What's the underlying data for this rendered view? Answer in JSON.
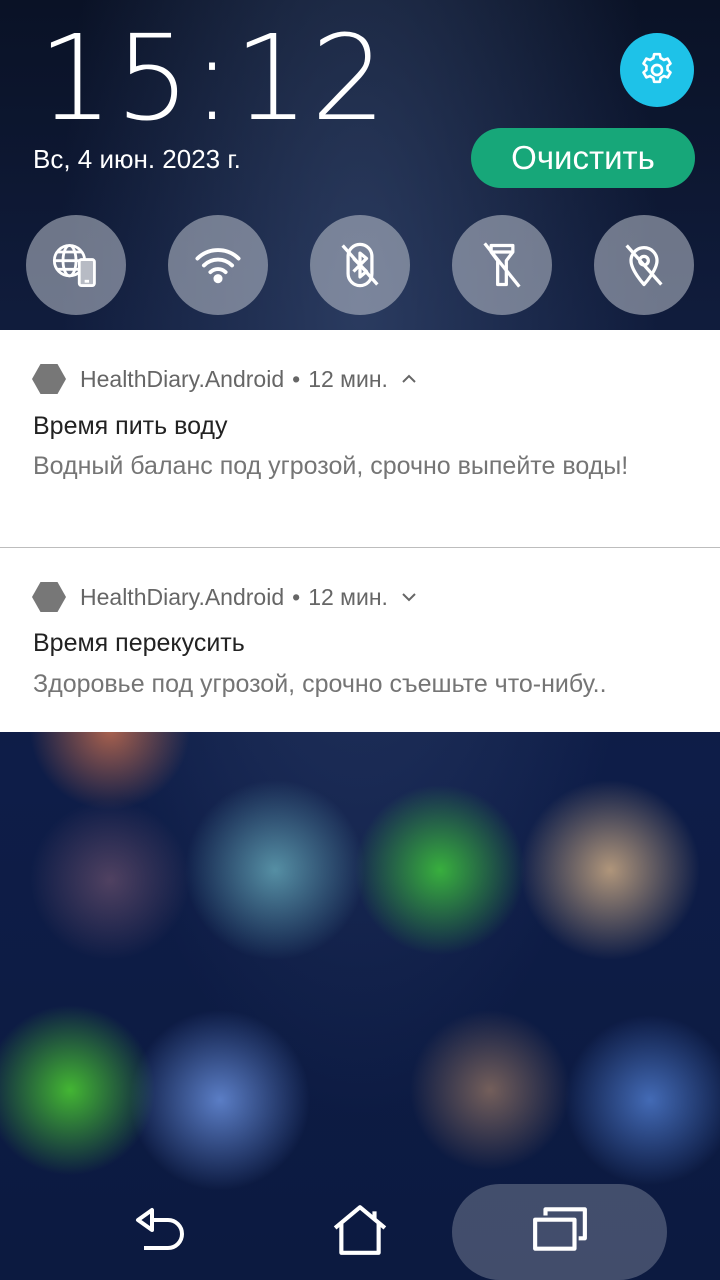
{
  "header": {
    "time": "15:12",
    "date": "Вс, 4 июн. 2023 г.",
    "clear_label": "Очистить",
    "settings_icon": "gear-icon",
    "accent_color": "#1ec2e8",
    "clear_color": "#17a779"
  },
  "quick_settings": [
    {
      "icon": "mobile-network-icon",
      "state": "on"
    },
    {
      "icon": "wifi-icon",
      "state": "on"
    },
    {
      "icon": "bluetooth-off-icon",
      "state": "off"
    },
    {
      "icon": "flashlight-off-icon",
      "state": "off"
    },
    {
      "icon": "location-off-icon",
      "state": "off"
    }
  ],
  "notifications": [
    {
      "app": "HealthDiary.Android",
      "separator": "•",
      "time": "12 мин.",
      "expanded": true,
      "title": "Время пить воду",
      "text": "Водный баланс под угрозой, срочно выпейте воды!"
    },
    {
      "app": "HealthDiary.Android",
      "separator": "•",
      "time": "12 мин.",
      "expanded": false,
      "title": "Время перекусить",
      "text": "Здоровье под угрозой, срочно съешьте что-нибу.."
    }
  ],
  "navbar": {
    "back_icon": "back-icon",
    "home_icon": "home-icon",
    "recents_icon": "recents-icon"
  }
}
